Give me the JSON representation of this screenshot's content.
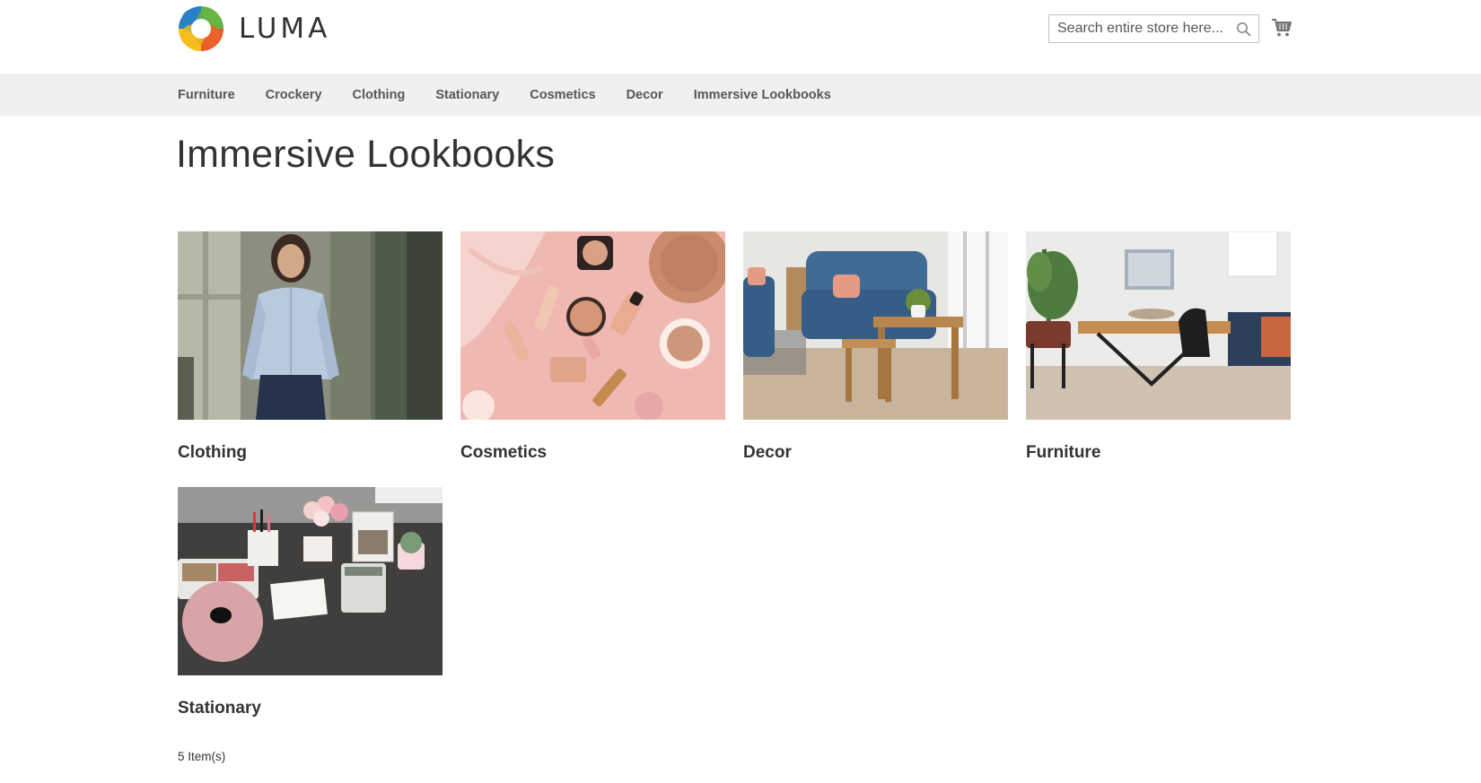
{
  "brand": {
    "name": "LUMA"
  },
  "search": {
    "placeholder": "Search entire store here..."
  },
  "nav": {
    "items": [
      "Furniture",
      "Crockery",
      "Clothing",
      "Stationary",
      "Cosmetics",
      "Decor",
      "Immersive Lookbooks"
    ]
  },
  "page": {
    "title": "Immersive Lookbooks"
  },
  "categories": [
    {
      "name": "Clothing"
    },
    {
      "name": "Cosmetics"
    },
    {
      "name": "Decor"
    },
    {
      "name": "Furniture"
    },
    {
      "name": "Stationary"
    }
  ],
  "toolbar": {
    "count": "5 Item(s)"
  },
  "colors": {
    "nav_bg": "#f0f0f0",
    "text": "#333333",
    "nav_text": "#575757"
  }
}
